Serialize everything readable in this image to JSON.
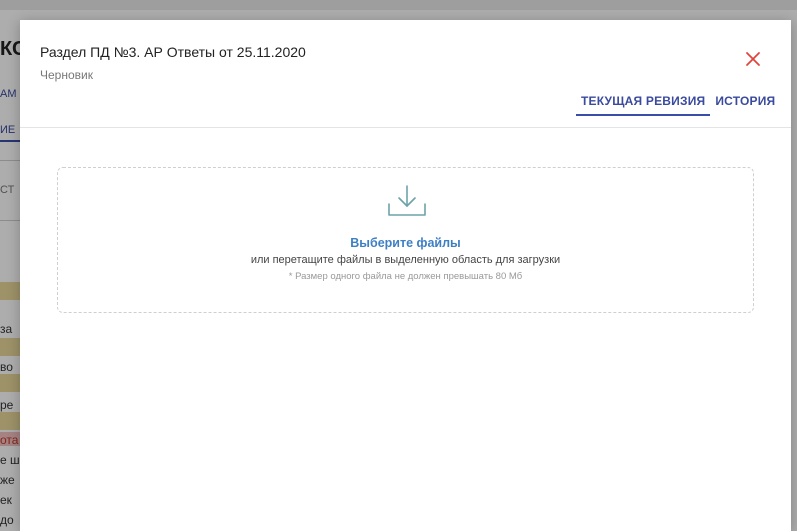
{
  "background": {
    "title_fragment": "КС",
    "fragments": [
      "АМ",
      "ИЕ",
      "СТ",
      "за",
      "во",
      "ре",
      "ота",
      "е ш",
      "же",
      "ек",
      "до"
    ]
  },
  "modal": {
    "title": "Раздел ПД №3. АР Ответы от 25.11.2020",
    "status": "Черновик",
    "close_icon": "close-icon",
    "close_color": "#e0453a",
    "tabs": [
      {
        "label": "ТЕКУЩАЯ РЕВИЗИЯ",
        "active": true
      },
      {
        "label": "ИСТОРИЯ",
        "active": false
      }
    ],
    "accent_color": "#3a4ea8"
  },
  "dropzone": {
    "icon": "download-tray-icon",
    "choose_label": "Выберите файлы",
    "hint": "или перетащите файлы в выделенную область для загрузки",
    "size_note": "* Размер одного файла не должен превышать 80 Мб"
  }
}
